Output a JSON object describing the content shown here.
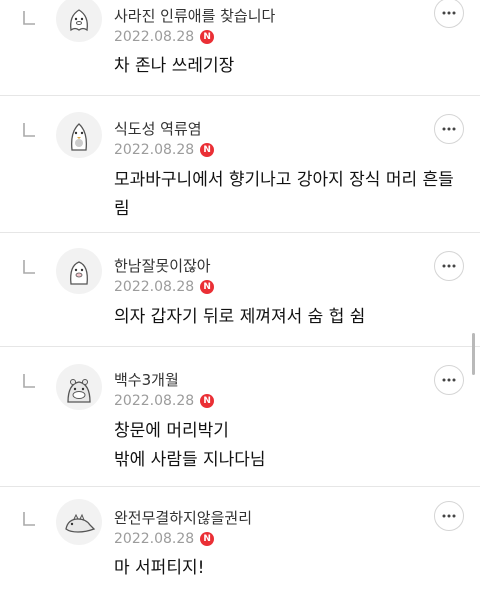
{
  "comments": [
    {
      "nickname": "사라진 인류애를 찾습니다",
      "date": "2022.08.28",
      "badge": "N",
      "lines": [
        "차 존나 쓰레기장"
      ],
      "avatar_icon": "ghost-avatar-icon"
    },
    {
      "nickname": "식도성 역류염",
      "date": "2022.08.28",
      "badge": "N",
      "lines": [
        "모과바구니에서 향기나고 강아지 장식 머리 흔들",
        "림"
      ],
      "avatar_icon": "penguin-avatar-icon"
    },
    {
      "nickname": "한남잘못이잖아",
      "date": "2022.08.28",
      "badge": "N",
      "lines": [
        "의자 갑자기 뒤로 제껴져서 숨 헙 쉼"
      ],
      "avatar_icon": "pig-avatar-icon"
    },
    {
      "nickname": "백수3개월",
      "date": "2022.08.28",
      "badge": "N",
      "lines": [
        "창문에 머리박기",
        "밖에 사람들 지나다님"
      ],
      "avatar_icon": "hippo-avatar-icon"
    },
    {
      "nickname": "완전무결하지않을권리",
      "date": "2022.08.28",
      "badge": "N",
      "lines": [
        "마 서퍼티지!"
      ],
      "avatar_icon": "dinosaur-avatar-icon"
    }
  ],
  "colors": {
    "badge": "#ea2f35",
    "date": "#9c9c9c",
    "divider": "#e6e6e6"
  },
  "icons": {
    "reply": "reply-arrow-icon",
    "more": "more-options-icon"
  }
}
